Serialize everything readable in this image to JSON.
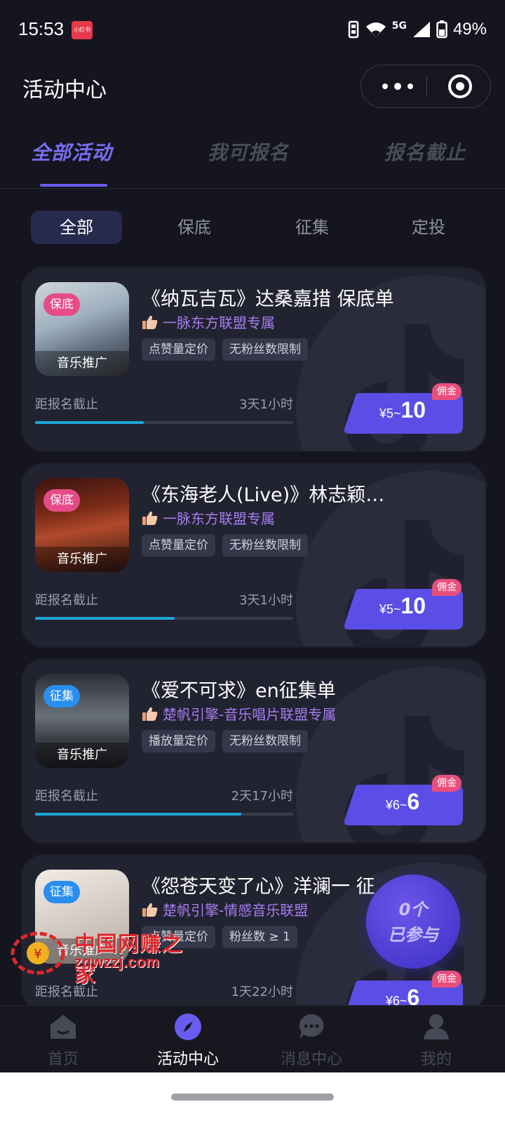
{
  "status_bar": {
    "time": "15:53",
    "app_badge": "小红书",
    "network": "5G",
    "battery": "49%"
  },
  "header": {
    "title": "活动中心"
  },
  "main_tabs": [
    {
      "label": "全部活动",
      "active": true
    },
    {
      "label": "我可报名",
      "active": false
    },
    {
      "label": "报名截止",
      "active": false
    }
  ],
  "filters": [
    {
      "label": "全部",
      "active": true
    },
    {
      "label": "保底",
      "active": false
    },
    {
      "label": "征集",
      "active": false
    },
    {
      "label": "定投",
      "active": false
    }
  ],
  "cards": [
    {
      "tag": "保底",
      "tag_color": "#e54b86",
      "thumb_label": "音乐推广",
      "title": "《纳瓦吉瓦》达桑嘉措 保底单",
      "alliance": "一脉东方联盟专属",
      "tags": [
        "点赞量定价",
        "无粉丝数限制"
      ],
      "deadline_label": "距报名截止",
      "deadline": "3天1小时",
      "progress": 0.42,
      "price_min": "¥5~",
      "price_max": "10",
      "commission": "佣金"
    },
    {
      "tag": "保底",
      "tag_color": "#e54b86",
      "thumb_label": "音乐推广",
      "title": "《东海老人(Live)》林志颖…",
      "alliance": "一脉东方联盟专属",
      "tags": [
        "点赞量定价",
        "无粉丝数限制"
      ],
      "deadline_label": "距报名截止",
      "deadline": "3天1小时",
      "progress": 0.54,
      "price_min": "¥5~",
      "price_max": "10",
      "commission": "佣金"
    },
    {
      "tag": "征集",
      "tag_color": "#2a8ef0",
      "thumb_label": "音乐推广",
      "title": "《爱不可求》en征集单",
      "alliance": "楚帆引擎-音乐唱片联盟专属",
      "tags": [
        "播放量定价",
        "无粉丝数限制"
      ],
      "deadline_label": "距报名截止",
      "deadline": "2天17小时",
      "progress": 0.8,
      "price_min": "¥6~",
      "price_max": "6",
      "commission": "佣金"
    },
    {
      "tag": "征集",
      "tag_color": "#2a8ef0",
      "thumb_label": "音乐推广",
      "title": "《怨苍天变了心》洋澜一 征",
      "alliance": "楚帆引擎-情感音乐联盟",
      "tags": [
        "点赞量定价",
        "粉丝数 ≥ 1"
      ],
      "deadline_label": "距报名截止",
      "deadline": "1天22小时",
      "progress": 0.0,
      "price_min": "¥6~",
      "price_max": "6",
      "commission": "佣金"
    }
  ],
  "joined": {
    "count": "0个",
    "label": "已参与"
  },
  "watermark": {
    "cn": "中国网赚之家",
    "url": "zgwzzj.com"
  },
  "bottom_nav": [
    {
      "label": "首页",
      "icon": "home-icon",
      "active": false
    },
    {
      "label": "活动中心",
      "icon": "compass-icon",
      "active": true
    },
    {
      "label": "消息中心",
      "icon": "chat-icon",
      "active": false
    },
    {
      "label": "我的",
      "icon": "user-icon",
      "active": false
    }
  ],
  "colors": {
    "accent": "#6a5cf0",
    "background": "#14151f",
    "card": "#222331",
    "progress": "#1ea6d6",
    "alliance": "#a57cf0"
  }
}
